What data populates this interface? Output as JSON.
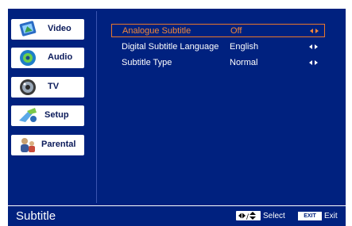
{
  "menu": {
    "items": [
      {
        "label": "Video",
        "icon": "video-icon"
      },
      {
        "label": "Audio",
        "icon": "audio-icon"
      },
      {
        "label": "TV",
        "icon": "tv-icon"
      },
      {
        "label": "Setup",
        "icon": "setup-icon",
        "selected": true
      },
      {
        "label": "Parental",
        "icon": "parental-icon"
      }
    ]
  },
  "settings": {
    "rows": [
      {
        "name": "Analogue Subtitle",
        "value": "Off",
        "highlighted": true
      },
      {
        "name": "Digital Subtitle Language",
        "value": "English"
      },
      {
        "name": "Subtitle Type",
        "value": "Normal"
      }
    ]
  },
  "footer": {
    "title": "Subtitle",
    "nav_key": "◀▶/⬍",
    "select_label": "Select",
    "exit_key": "EXIT",
    "exit_label": "Exit"
  },
  "colors": {
    "panel_bg": "#00217f",
    "highlight": "#f2863a",
    "text": "#ffffff"
  }
}
